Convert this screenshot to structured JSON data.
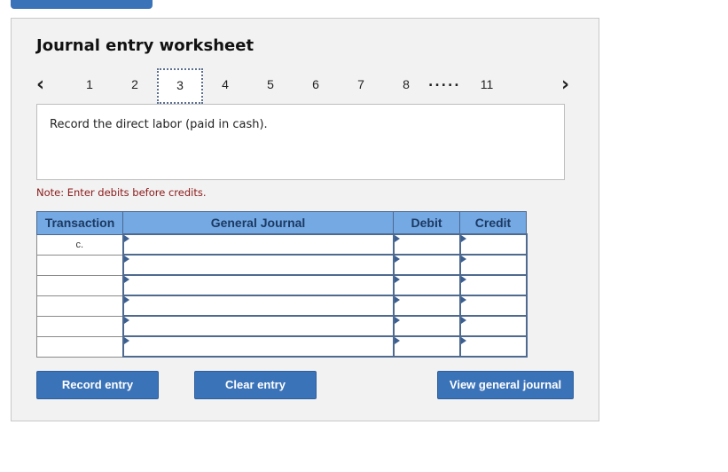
{
  "worksheet": {
    "title": "Journal entry worksheet",
    "nav": {
      "prev_icon": "chevron-left-icon",
      "next_icon": "chevron-right-icon",
      "prev_glyph": "‹",
      "next_glyph": "›",
      "pages": [
        "1",
        "2",
        "3",
        "4",
        "5",
        "6",
        "7",
        "8"
      ],
      "ellipsis": ".....",
      "last_page": "11",
      "active_page": "3"
    },
    "question": "Record the direct labor (paid in cash).",
    "note": "Note: Enter debits before credits.",
    "table": {
      "headers": [
        "Transaction",
        "General Journal",
        "Debit",
        "Credit"
      ],
      "rows": [
        {
          "transaction": "c.",
          "account": "",
          "debit": "",
          "credit": ""
        },
        {
          "transaction": "",
          "account": "",
          "debit": "",
          "credit": ""
        },
        {
          "transaction": "",
          "account": "",
          "debit": "",
          "credit": ""
        },
        {
          "transaction": "",
          "account": "",
          "debit": "",
          "credit": ""
        },
        {
          "transaction": "",
          "account": "",
          "debit": "",
          "credit": ""
        },
        {
          "transaction": "",
          "account": "",
          "debit": "",
          "credit": ""
        }
      ]
    },
    "buttons": {
      "record": "Record entry",
      "clear": "Clear entry",
      "view": "View general journal"
    }
  },
  "colors": {
    "button_blue": "#3b73b9",
    "header_blue": "#75a9e3",
    "note_red": "#8b1a1a"
  }
}
